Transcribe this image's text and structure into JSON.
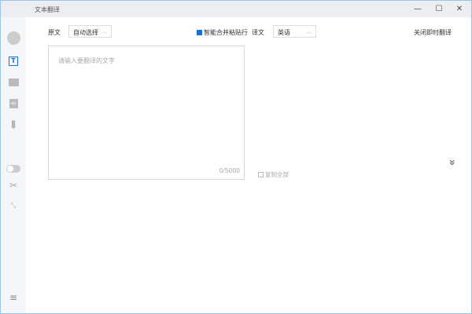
{
  "window": {
    "title": "文本翻译",
    "minimize": "—",
    "maximize": "☐",
    "close": "✕"
  },
  "sidebar": {
    "items": [
      "avatar",
      "text-translate-icon",
      "folder-icon",
      "image-text-icon",
      "library-icon",
      "toggle",
      "scissors-icon",
      "collapse-icon",
      "menu-icon"
    ]
  },
  "source": {
    "label": "原文",
    "language": "自动选择",
    "placeholder": "请输入要翻译的文字",
    "counter": "0/5000"
  },
  "smart_merge": {
    "label": "智能合并粘贴行",
    "checked": true
  },
  "target": {
    "label": "译文",
    "language": "英语"
  },
  "close_instant": "关闭即时翻译",
  "copy_all": "复制全部",
  "colors": {
    "accent": "#1a6fd8",
    "border": "#9cc3ea"
  }
}
